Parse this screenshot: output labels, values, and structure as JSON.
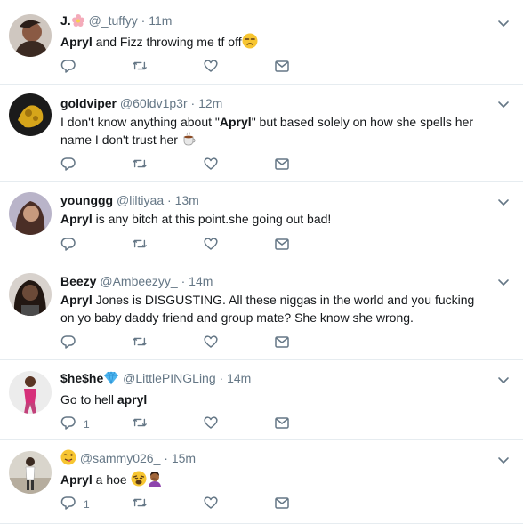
{
  "tweets": [
    {
      "name": "J.",
      "handle": "@_tuffyy",
      "time": "11m",
      "t1_bold": "Apryl",
      "t1_rest": " and Fizz throwing me tf off",
      "reply_count": "",
      "avatar_color": "#3b2a22"
    },
    {
      "name": "goldviper",
      "handle": "@60ldv1p3r",
      "time": "12m",
      "t_pre": "I don't know anything about \"",
      "t_bold": "Apryl",
      "t_post": "\" but based solely on how she spells her name I don't trust her",
      "reply_count": "",
      "avatar_color": "#d6a51a"
    },
    {
      "name": "younggg",
      "handle": "@liltiyaa",
      "time": "13m",
      "t1_bold": "Apryl",
      "t1_rest": " is any bitch at this point.she going out bad!",
      "reply_count": "",
      "avatar_color": "#4a2e26"
    },
    {
      "name": "Beezy",
      "handle": "@Ambeezyy_",
      "time": "14m",
      "t1_bold": "Apryl",
      "t1_rest": " Jones is DISGUSTING. All these niggas in the world and you fucking on yo baby daddy friend and group mate? She know she wrong.",
      "reply_count": "",
      "avatar_color": "#221712"
    },
    {
      "name": "$he$he",
      "handle": "@LittlePINGLing",
      "time": "14m",
      "t_pre": "Go to hell ",
      "t_bold": "apryl",
      "reply_count": "1",
      "avatar_color": "#c2407a"
    },
    {
      "name": "",
      "handle": "@sammy026_",
      "time": "15m",
      "t1_bold": "Apryl",
      "t1_rest": " a hoe",
      "reply_count": "1",
      "avatar_color": "#8b7d6b"
    }
  ],
  "dot": "·",
  "icons": {
    "reply": "reply-icon",
    "retweet": "retweet-icon",
    "like": "heart-icon",
    "dm": "envelope-icon",
    "menu": "chevron-down-icon"
  },
  "colors": {
    "muted": "#657786",
    "text": "#14171a",
    "divider": "#e6ecf0"
  }
}
